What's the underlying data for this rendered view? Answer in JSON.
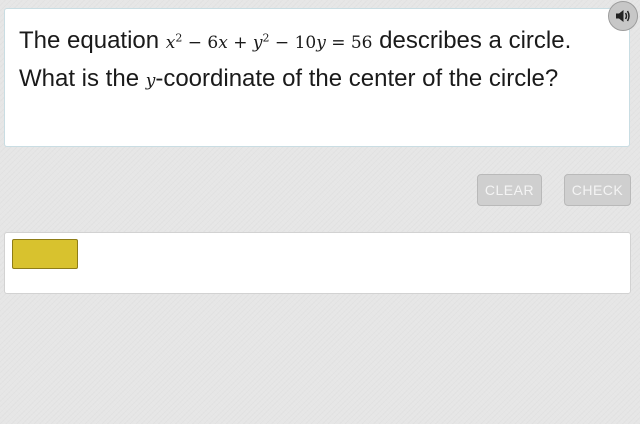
{
  "question": {
    "before_math": "The equation ",
    "after_math": " describes a circle. What is the ",
    "variable": "y",
    "after_variable": "-coordinate of the center of the circle?",
    "equation": {
      "x": "x",
      "exp1": "2",
      "minus1": " − 6",
      "x2": "x",
      "plus": " + ",
      "y": "y",
      "exp2": "2",
      "minus2": " − 10",
      "y2": "y",
      "equals": " = 56"
    }
  },
  "toolbar": {
    "clear_label": "CLEAR",
    "check_label": "CHECK"
  },
  "answer": {
    "value": ""
  },
  "icons": {
    "audio": "speaker-icon"
  },
  "colors": {
    "answer_fill": "#d8c22e",
    "button_bg": "#cfcfcf"
  }
}
